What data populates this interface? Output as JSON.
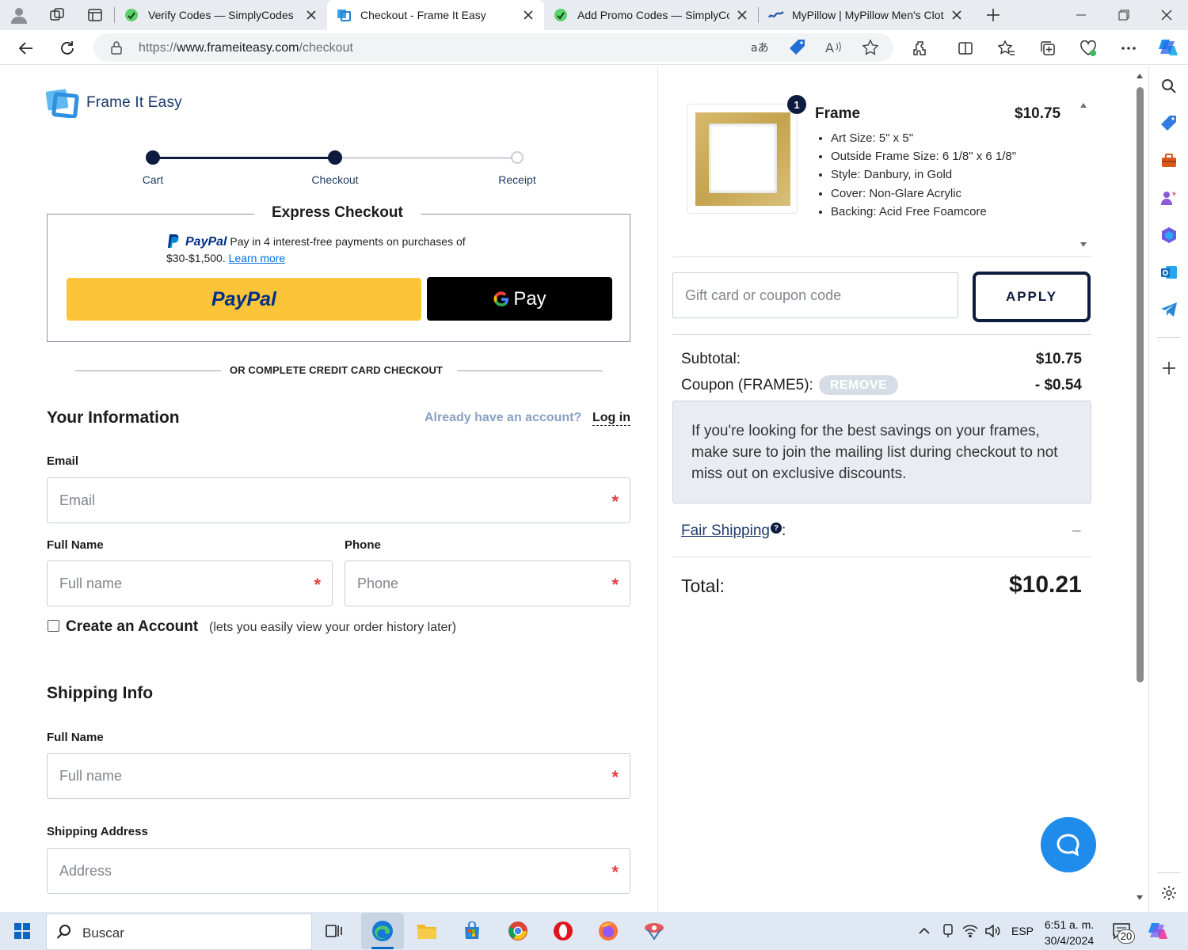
{
  "browser": {
    "tabs": [
      {
        "title": "Verify Codes — SimplyCodes",
        "active": false
      },
      {
        "title": "Checkout - Frame It Easy",
        "active": true
      },
      {
        "title": "Add Promo Codes — SimplyCodes",
        "active": false
      },
      {
        "title": "MyPillow | MyPillow Men's Clothing",
        "active": false
      }
    ],
    "url_prefix": "https://",
    "url_domain": "www.frameiteasy.com",
    "url_path": "/checkout"
  },
  "brand": {
    "name": "Frame It Easy",
    "color": "#173967"
  },
  "steps": [
    {
      "label": "Cart"
    },
    {
      "label": "Checkout"
    },
    {
      "label": "Receipt"
    }
  ],
  "express": {
    "title": "Express Checkout",
    "paypal_brand": "PayPal",
    "paypal_msg_line1": "Pay in 4 interest-free payments on purchases of",
    "paypal_msg_line2": "$30-$1,500.",
    "learn_more": "Learn more",
    "paypal_button": "PayPal",
    "gpay_button": "Pay"
  },
  "divider_text": "OR COMPLETE CREDIT CARD CHECKOUT",
  "your_info": {
    "title": "Your Information",
    "already": "Already have an account?",
    "login": "Log in",
    "email_label": "Email",
    "email_placeholder": "Email",
    "fullname_label": "Full Name",
    "fullname_placeholder": "Full name",
    "phone_label": "Phone",
    "phone_placeholder": "Phone",
    "create_account": "Create an Account",
    "create_hint": "(lets you easily view your order history later)",
    "required_mark": "*"
  },
  "shipping": {
    "title": "Shipping Info",
    "fullname_label": "Full Name",
    "fullname_placeholder": "Full name",
    "address_label": "Shipping Address",
    "address_placeholder": "Address"
  },
  "cart": {
    "quantity": "1",
    "item_name": "Frame",
    "item_price": "$10.75",
    "specs": [
      "Art Size: 5\" x 5\"",
      "Outside Frame Size: 6 1/8\" x 6 1/8\"",
      "Style: Danbury, in Gold",
      "Cover: Non-Glare Acrylic",
      "Backing: Acid Free Foamcore"
    ]
  },
  "coupon": {
    "placeholder": "Gift card or coupon code",
    "apply": "APPLY"
  },
  "summary": {
    "subtotal_label": "Subtotal:",
    "subtotal_value": "$10.75",
    "coupon_label": "Coupon (FRAME5):",
    "remove": "REMOVE",
    "coupon_value": "- $0.54",
    "tip": "If you're looking for the best savings on your frames, make sure to join the mailing list during checkout to not miss out on exclusive discounts.",
    "shipping_label": "Fair Shipping",
    "shipping_colon": ":",
    "shipping_value": "–",
    "total_label": "Total:",
    "total_value": "$10.21"
  },
  "taskbar": {
    "search": "Buscar",
    "lang": "ESP",
    "time": "6:51 a. m.",
    "date": "30/4/2024",
    "notif_count": "20"
  }
}
